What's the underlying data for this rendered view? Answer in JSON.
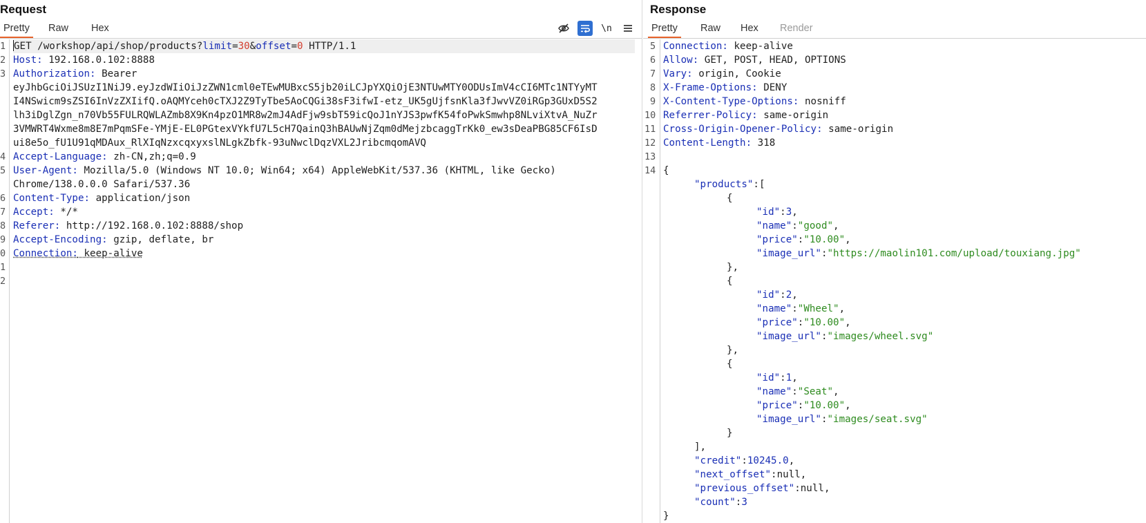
{
  "request": {
    "title": "Request",
    "tabs": [
      "Pretty",
      "Raw",
      "Hex"
    ],
    "toolbar": {
      "hide_icon": "eye-off-icon",
      "wrap_icon": "text-wrap-icon",
      "newline_label": "\\n",
      "menu_icon": "hamburger-menu-icon"
    },
    "lines": {
      "l1_method": "GET",
      "l1_path": " /workshop/api/shop/products?",
      "l1_p1": "limit",
      "l1_eq1": "=",
      "l1_v1": "30",
      "l1_amp": "&",
      "l1_p2": "offset",
      "l1_eq2": "=",
      "l1_v2": "0",
      "l1_proto": " HTTP/1.1",
      "host_key": "Host:",
      "host_val": " 192.168.0.102:8888",
      "auth_key": "Authorization:",
      "auth_val": " Bearer",
      "token_1": "eyJhbGciOiJSUzI1NiJ9.eyJzdWIiOiJzZWN1cml0eTEwMUBxcS5jb20iLCJpYXQiOjE3NTUwMTY0ODUsImV4cCI6MTc1NTYyMT",
      "token_2": "I4NSwicm9sZSI6InVzZXIifQ.oAQMYceh0cTXJ2Z9TyTbe5AoCQGi38sF3ifwI-etz_UK5gUjfsnKla3fJwvVZ0iRGp3GUxD5S2",
      "token_3": "lh3iDglZgn_n70Vb55FULRQWLAZmb8X9Kn4pzO1MR8w2mJ4AdFjw9sbT59icQoJ1nYJS3pwfK54foPwkSmwhp8NLviXtvA_NuZr",
      "token_4": "3VMWRT4Wxme8m8E7mPqmSFe-YMjE-EL0PGtexVYkfU7L5cH7QainQ3hBAUwNjZqm0dMejzbcaggTrKk0_ew3sDeaPBG85CF6IsD",
      "token_5": "ui8e5o_fU1U91qMDAux_RlXIqNzxcqxyxslNLgkZbfk-93uNwclDqzVXL2JribcmqomAVQ",
      "lang_key": "Accept-Language:",
      "lang_val": " zh-CN,zh;q=0.9",
      "ua_key": "User-Agent:",
      "ua_val_1": " Mozilla/5.0 (Windows NT 10.0; Win64; x64) AppleWebKit/537.36 (KHTML, like Gecko)",
      "ua_val_2": "Chrome/138.0.0.0 Safari/537.36",
      "ct_key": "Content-Type:",
      "ct_val": " application/json",
      "accept_key": "Accept:",
      "accept_val": " */*",
      "ref_key": "Referer:",
      "ref_val": " http://192.168.0.102:8888/shop",
      "enc_key": "Accept-Encoding:",
      "enc_val": " gzip, deflate, br",
      "conn_key": "Connection:",
      "conn_val": " keep-alive"
    },
    "line_numbers": [
      "1",
      "2",
      "3",
      "4",
      "5",
      "6",
      "7",
      "8",
      "9",
      "0",
      "1",
      "2"
    ]
  },
  "response": {
    "title": "Response",
    "tabs": [
      "Pretty",
      "Raw",
      "Hex",
      "Render"
    ],
    "line_numbers": [
      "5",
      "6",
      "7",
      "8",
      "9",
      "10",
      "11",
      "12",
      "13",
      "14"
    ],
    "headers": {
      "conn_key": "Connection:",
      "conn_val": " keep-alive",
      "allow_key": "Allow:",
      "allow_val": " GET, POST, HEAD, OPTIONS",
      "vary_key": "Vary:",
      "vary_val": " origin, Cookie",
      "xfo_key": "X-Frame-Options:",
      "xfo_val": " DENY",
      "xcto_key": "X-Content-Type-Options:",
      "xcto_val": " nosniff",
      "rp_key": "Referrer-Policy:",
      "rp_val": " same-origin",
      "coop_key": "Cross-Origin-Opener-Policy:",
      "coop_val": " same-origin",
      "cl_key": "Content-Length:",
      "cl_val": " 318"
    },
    "json": {
      "open_brace": "{",
      "products_key": "\"products\"",
      "open_bracket": ":[",
      "items": [
        {
          "id": "3",
          "name": "\"good\"",
          "price": "\"10.00\"",
          "image_url": "\"https://maolin101.com/upload/touxiang.jpg\""
        },
        {
          "id": "2",
          "name": "\"Wheel\"",
          "price": "\"10.00\"",
          "image_url": "\"images/wheel.svg\""
        },
        {
          "id": "1",
          "name": "\"Seat\"",
          "price": "\"10.00\"",
          "image_url": "\"images/seat.svg\""
        }
      ],
      "keys": {
        "id": "\"id\"",
        "name": "\"name\"",
        "price": "\"price\"",
        "image_url": "\"image_url\""
      },
      "item_open": "{",
      "item_close_comma": "},",
      "item_close": "}",
      "close_bracket": "],",
      "credit_key": "\"credit\"",
      "credit_val": "10245.0",
      "next_key": "\"next_offset\"",
      "next_val": "null",
      "prev_key": "\"previous_offset\"",
      "prev_val": "null",
      "count_key": "\"count\"",
      "count_val": "3",
      "close_brace": "}"
    }
  },
  "colors": {
    "accent": "#e8632b",
    "key_blue": "#1a2fb5",
    "string_green": "#2e8b1f",
    "number_red": "#d23d2e",
    "wrap_btn": "#2f6fd1"
  }
}
